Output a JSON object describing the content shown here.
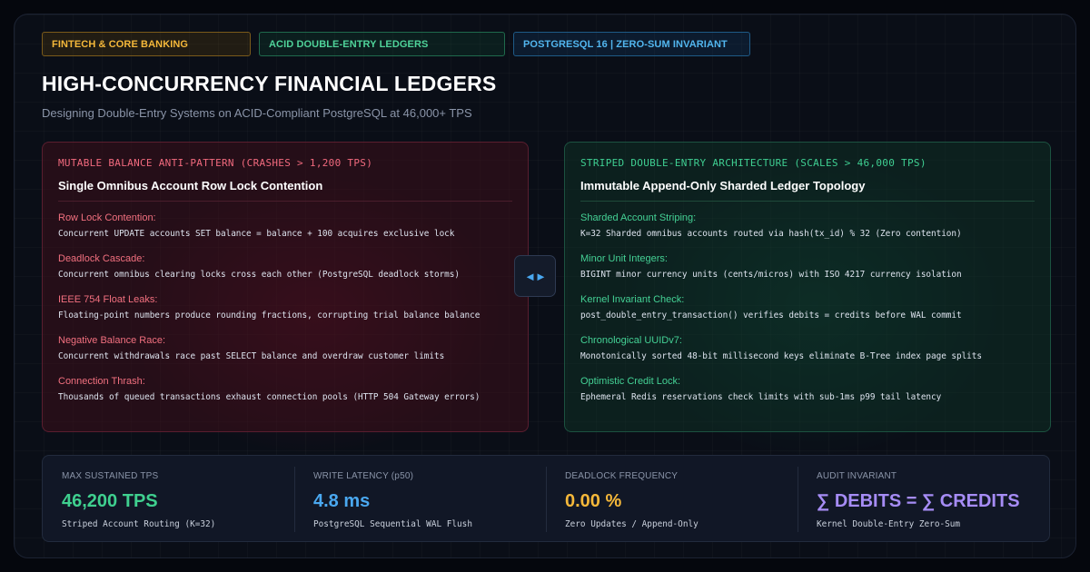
{
  "tags": [
    "FINTECH & CORE BANKING",
    "ACID DOUBLE-ENTRY LEDGERS",
    "POSTGRESQL 16 | ZERO-SUM INVARIANT"
  ],
  "title": "HIGH-CONCURRENCY FINANCIAL LEDGERS",
  "subtitle": "Designing Double-Entry Systems on ACID-Compliant PostgreSQL at 46,000+ TPS",
  "left_panel": {
    "kicker": "MUTABLE BALANCE ANTI-PATTERN (CRASHES > 1,200 TPS)",
    "title": "Single Omnibus Account Row Lock Contention",
    "items": [
      {
        "label": "Row Lock Contention:",
        "desc": "Concurrent UPDATE accounts SET balance = balance + 100 acquires exclusive lock"
      },
      {
        "label": "Deadlock Cascade:",
        "desc": "Concurrent omnibus clearing locks cross each other (PostgreSQL deadlock storms)"
      },
      {
        "label": "IEEE 754 Float Leaks:",
        "desc": "Floating-point numbers produce rounding fractions, corrupting trial balance balance"
      },
      {
        "label": "Negative Balance Race:",
        "desc": "Concurrent withdrawals race past SELECT balance and overdraw customer limits"
      },
      {
        "label": "Connection Thrash:",
        "desc": "Thousands of queued transactions exhaust connection pools (HTTP 504 Gateway errors)"
      }
    ]
  },
  "right_panel": {
    "kicker": "STRIPED DOUBLE-ENTRY ARCHITECTURE (SCALES > 46,000 TPS)",
    "title": "Immutable Append-Only Sharded Ledger Topology",
    "items": [
      {
        "label": "Sharded Account Striping:",
        "desc": "K=32 Sharded omnibus accounts routed via hash(tx_id) % 32 (Zero contention)"
      },
      {
        "label": "Minor Unit Integers:",
        "desc": "BIGINT minor currency units (cents/micros) with ISO 4217 currency isolation"
      },
      {
        "label": "Kernel Invariant Check:",
        "desc": "post_double_entry_transaction() verifies debits = credits before WAL commit"
      },
      {
        "label": "Chronological UUIDv7:",
        "desc": "Monotonically sorted 48-bit millisecond keys eliminate B-Tree index page splits"
      },
      {
        "label": "Optimistic Credit Lock:",
        "desc": "Ephemeral Redis reservations check limits with sub-1ms p99 tail latency"
      }
    ]
  },
  "swap_icon": "◄►",
  "stats": [
    {
      "label": "MAX SUSTAINED TPS",
      "value": "46,200 TPS",
      "note": "Striped Account Routing (K=32)",
      "color": "#3fd08f"
    },
    {
      "label": "WRITE LATENCY (p50)",
      "value": "4.8 ms",
      "note": "PostgreSQL Sequential WAL Flush",
      "color": "#4aa8f0"
    },
    {
      "label": "DEADLOCK FREQUENCY",
      "value": "0.00 %",
      "note": "Zero Updates / Append-Only",
      "color": "#f5b83a"
    },
    {
      "label": "AUDIT INVARIANT",
      "value": "∑ DEBITS = ∑ CREDITS",
      "note": "Kernel Double-Entry Zero-Sum",
      "color": "#a68cf5"
    }
  ]
}
